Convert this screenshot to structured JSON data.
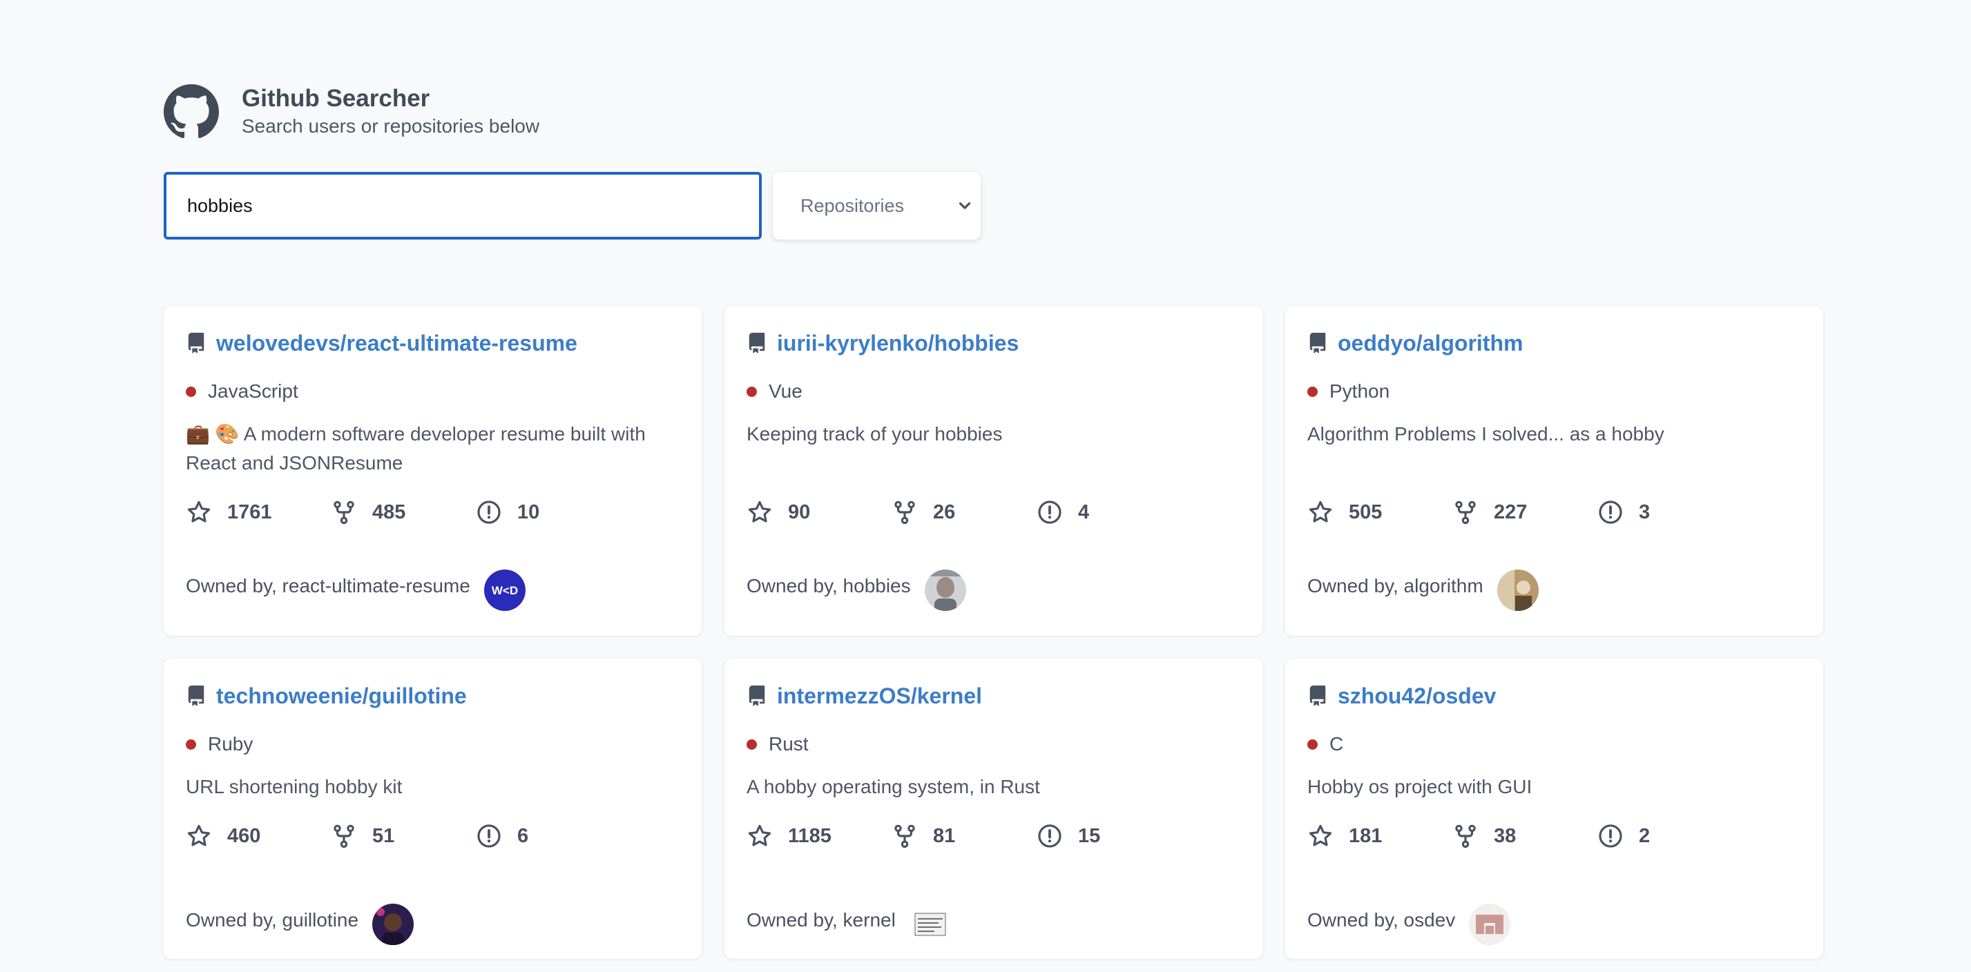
{
  "app": {
    "title": "Github Searcher",
    "subtitle": "Search users or repositories below"
  },
  "search": {
    "value": "hobbies",
    "type_selected": "Repositories"
  },
  "owned_prefix": "Owned by,",
  "icons": {
    "logo": "github-octocat-icon",
    "repo": "repo-book-icon",
    "language": "language-dot",
    "stars": "star-icon",
    "forks": "fork-icon",
    "issues": "issue-icon",
    "select": "chevron-down-icon"
  },
  "colors": {
    "accent": "#3c7dc8",
    "input_border": "#1e64c8",
    "language_dot": "#b5312a"
  },
  "repos": [
    {
      "full_name": "welovedevs/react-ultimate-resume",
      "language": "JavaScript",
      "description": "💼 🎨 A modern software developer resume built with React and JSONResume",
      "stars": "1761",
      "forks": "485",
      "issues": "10",
      "owner_label": "Owned by, react-ultimate-resume"
    },
    {
      "full_name": "iurii-kyrylenko/hobbies",
      "language": "Vue",
      "description": "Keeping track of your hobbies",
      "stars": "90",
      "forks": "26",
      "issues": "4",
      "owner_label": "Owned by, hobbies"
    },
    {
      "full_name": "oeddyo/algorithm",
      "language": "Python",
      "description": "Algorithm Problems I solved... as a hobby",
      "stars": "505",
      "forks": "227",
      "issues": "3",
      "owner_label": "Owned by, algorithm"
    },
    {
      "full_name": "technoweenie/guillotine",
      "language": "Ruby",
      "description": "URL shortening hobby kit",
      "stars": "460",
      "forks": "51",
      "issues": "6",
      "owner_label": "Owned by, guillotine"
    },
    {
      "full_name": "intermezzOS/kernel",
      "language": "Rust",
      "description": "A hobby operating system, in Rust",
      "stars": "1185",
      "forks": "81",
      "issues": "15",
      "owner_label": "Owned by, kernel"
    },
    {
      "full_name": "szhou42/osdev",
      "language": "C",
      "description": "Hobby os project with GUI",
      "stars": "181",
      "forks": "38",
      "issues": "2",
      "owner_label": "Owned by, osdev"
    }
  ]
}
